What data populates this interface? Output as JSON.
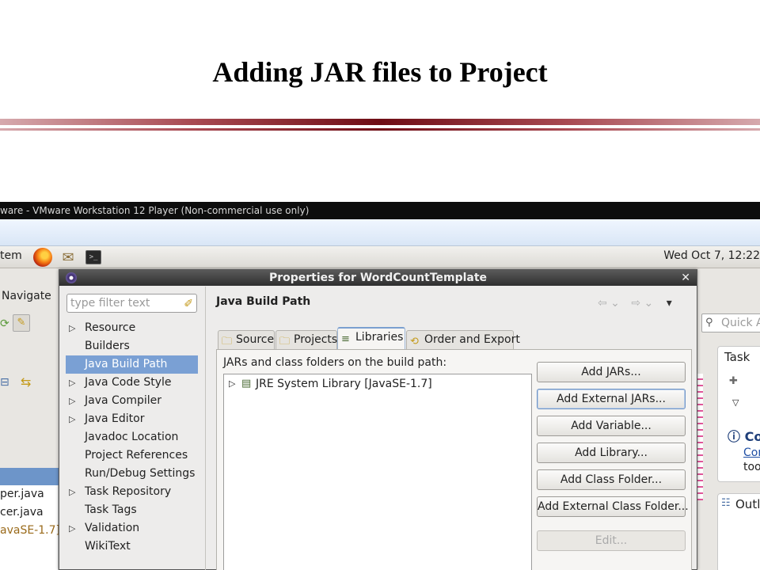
{
  "slide": {
    "title": "Adding JAR files to Project"
  },
  "vm": {
    "window_title": "ware - VMware Workstation 12 Player (Non-commercial use only)"
  },
  "gnome_panel": {
    "menu_label": "tem",
    "clock": "Wed Oct  7, 12:22",
    "icons": [
      "firefox-icon",
      "cake-icon",
      "terminal-icon"
    ]
  },
  "eclipse_bg": {
    "menu_navigate": "Navigate",
    "files": [
      "per.java",
      "cer.java",
      "avaSE-1.7]"
    ],
    "quick_access_placeholder": "Quick A",
    "task_label": "Task",
    "co_label": "Co",
    "con_link": "Con",
    "too_label": "too",
    "outline_label": "Outl"
  },
  "dialog": {
    "title": "Properties for WordCountTemplate",
    "filter_placeholder": "type filter text",
    "nav_items": [
      {
        "label": "Resource",
        "expandable": true,
        "selected": false
      },
      {
        "label": "Builders",
        "expandable": false,
        "selected": false
      },
      {
        "label": "Java Build Path",
        "expandable": false,
        "selected": true
      },
      {
        "label": "Java Code Style",
        "expandable": true,
        "selected": false
      },
      {
        "label": "Java Compiler",
        "expandable": true,
        "selected": false
      },
      {
        "label": "Java Editor",
        "expandable": true,
        "selected": false
      },
      {
        "label": "Javadoc Location",
        "expandable": false,
        "selected": false
      },
      {
        "label": "Project References",
        "expandable": false,
        "selected": false
      },
      {
        "label": "Run/Debug Settings",
        "expandable": false,
        "selected": false
      },
      {
        "label": "Task Repository",
        "expandable": true,
        "selected": false
      },
      {
        "label": "Task Tags",
        "expandable": false,
        "selected": false
      },
      {
        "label": "Validation",
        "expandable": true,
        "selected": false
      },
      {
        "label": "WikiText",
        "expandable": false,
        "selected": false
      }
    ],
    "page_title": "Java Build Path",
    "tabs": [
      {
        "label": "Source",
        "active": false
      },
      {
        "label": "Projects",
        "active": false
      },
      {
        "label": "Libraries",
        "active": true
      },
      {
        "label": "Order and Export",
        "active": false
      }
    ],
    "libraries_label": "JARs and class folders on the build path:",
    "library_entries": [
      "JRE System Library [JavaSE-1.7]"
    ],
    "buttons": [
      {
        "label": "Add JARs...",
        "state": "normal"
      },
      {
        "label": "Add External JARs...",
        "state": "focused"
      },
      {
        "label": "Add Variable...",
        "state": "normal"
      },
      {
        "label": "Add Library...",
        "state": "normal"
      },
      {
        "label": "Add Class Folder...",
        "state": "normal"
      },
      {
        "label": "Add External Class Folder...",
        "state": "normal"
      },
      {
        "label": "Edit...",
        "state": "disabled"
      }
    ]
  },
  "colors": {
    "accent_rule": "#6e0d15",
    "selection": "#7aa0d4",
    "dialog_title_bar": "#3a3a3a"
  }
}
